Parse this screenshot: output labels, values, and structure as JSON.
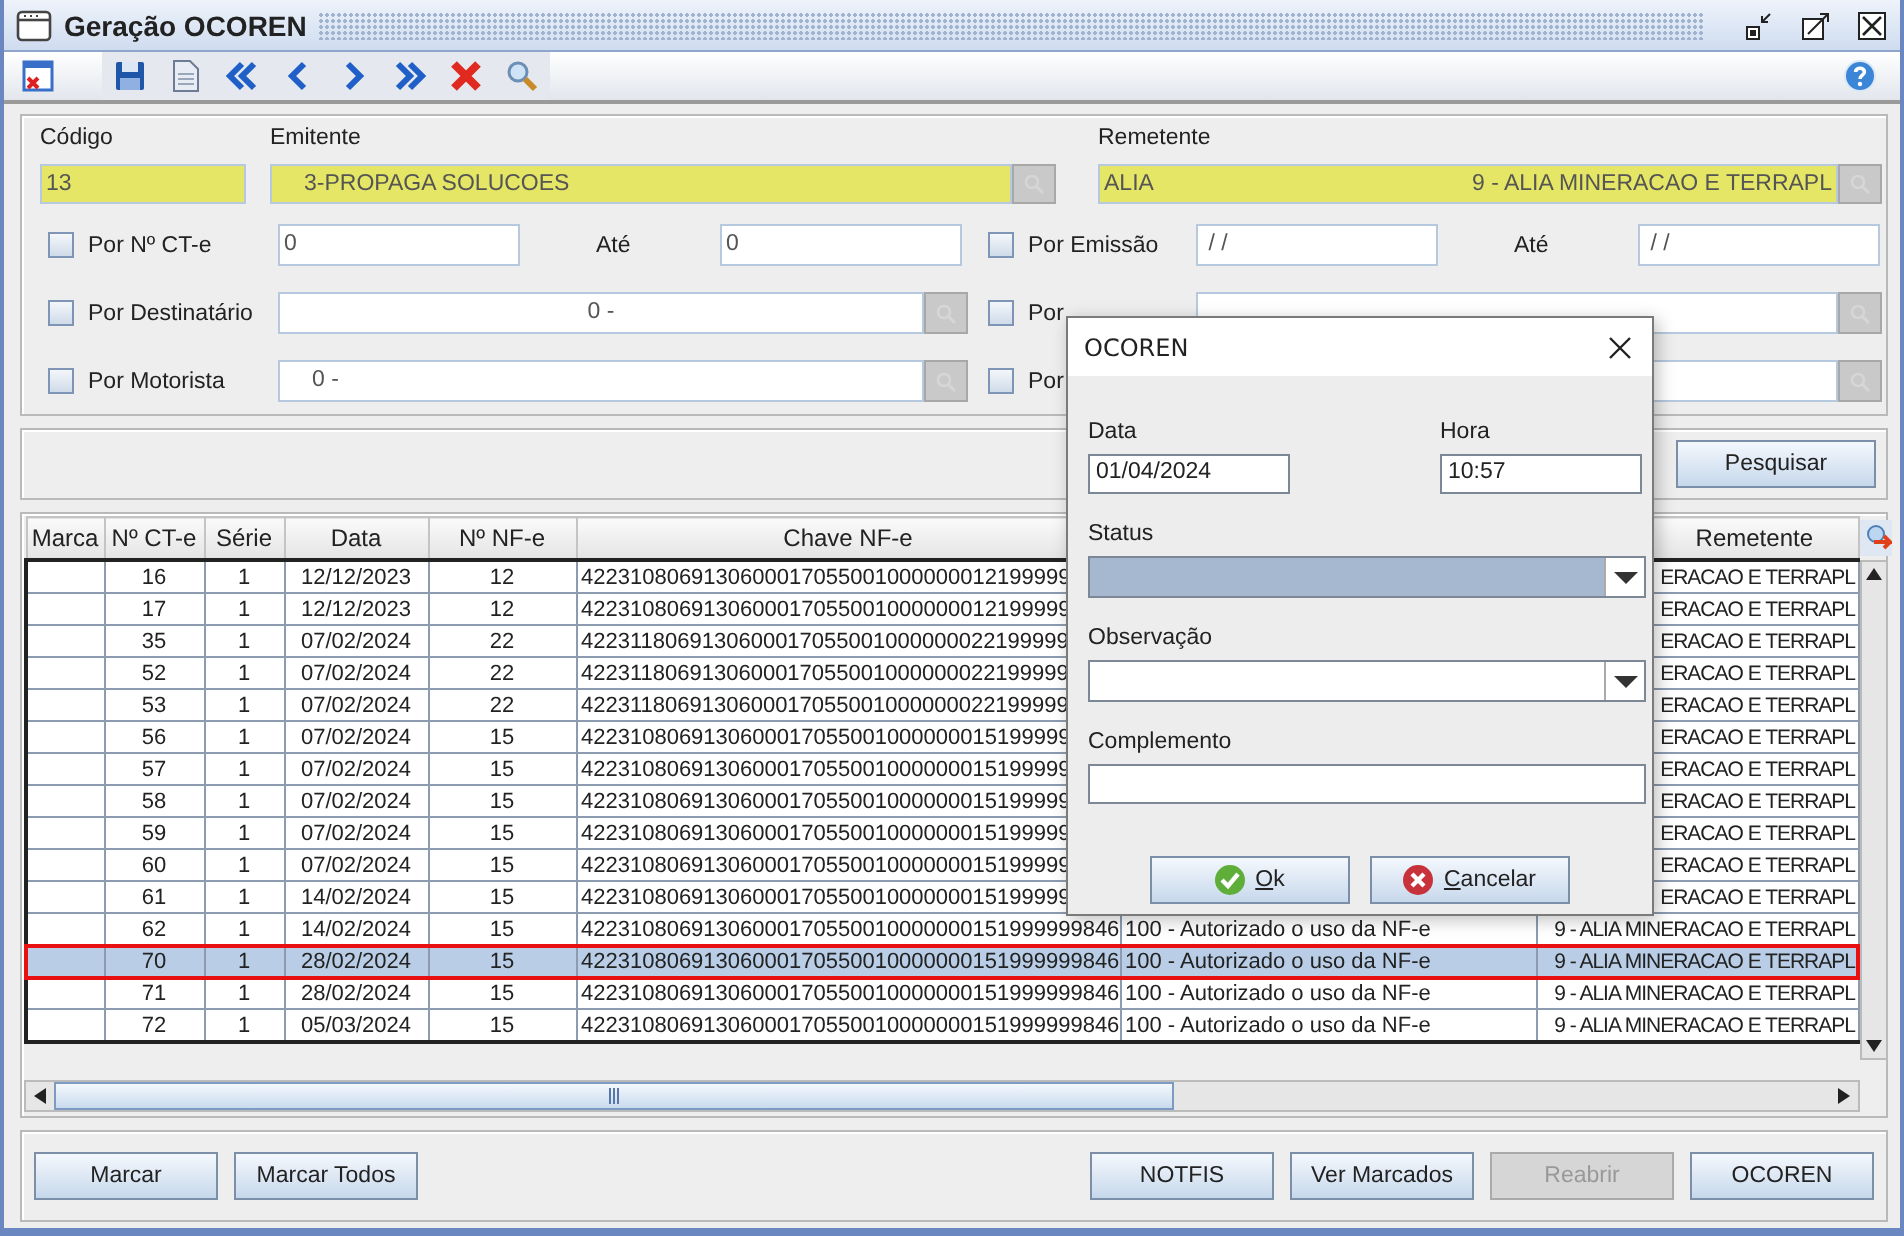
{
  "window": {
    "title": "Geração OCOREN"
  },
  "codigo": {
    "label": "Código",
    "value": "13"
  },
  "emitente": {
    "label": "Emitente",
    "value": "3-PROPAGA SOLUCOES"
  },
  "remetente": {
    "label": "Remetente",
    "code": "ALIA",
    "name": "9 - ALIA MINERACAO E TERRAPL"
  },
  "filters_left": [
    {
      "kind": "range",
      "label": "Por Nº CT-e",
      "checked": false,
      "from": "0",
      "to_label": "Até",
      "to": "0"
    },
    {
      "kind": "lookup",
      "label": "Por Destinatário",
      "checked": false,
      "value": "0 -",
      "centered": true
    },
    {
      "kind": "lookup",
      "label": "Por Motorista",
      "checked": false,
      "value": "0 -",
      "centered": false
    }
  ],
  "filters_right": [
    {
      "kind": "range",
      "label": "Por Emissão",
      "checked": false,
      "from": " / /",
      "to_label": "Até",
      "to": " / /"
    },
    {
      "kind": "lookup",
      "label": "Por",
      "checked": false
    },
    {
      "kind": "lookup",
      "label": "Por",
      "checked": false
    }
  ],
  "search_button": "Pesquisar",
  "table": {
    "columns": [
      "Marca",
      "Nº CT-e",
      "Série",
      "Data",
      "Nº NF-e",
      "Chave NF-e",
      null,
      "Remetente"
    ],
    "rows": [
      {
        "cells": [
          null,
          "16",
          "1",
          "12/12/2023",
          "12",
          "4223108069130600017055001000000012199999",
          null,
          "ERACAO E TERRAPL"
        ],
        "selected": false
      },
      {
        "cells": [
          null,
          "17",
          "1",
          "12/12/2023",
          "12",
          "4223108069130600017055001000000012199999",
          null,
          "ERACAO E TERRAPL"
        ],
        "selected": false
      },
      {
        "cells": [
          null,
          "35",
          "1",
          "07/02/2024",
          "22",
          "4223118069130600017055001000000022199999",
          null,
          "ERACAO E TERRAPL"
        ],
        "selected": false
      },
      {
        "cells": [
          null,
          "52",
          "1",
          "07/02/2024",
          "22",
          "4223118069130600017055001000000022199999",
          null,
          "ERACAO E TERRAPL"
        ],
        "selected": false
      },
      {
        "cells": [
          null,
          "53",
          "1",
          "07/02/2024",
          "22",
          "4223118069130600017055001000000022199999",
          null,
          "ERACAO E TERRAPL"
        ],
        "selected": false
      },
      {
        "cells": [
          null,
          "56",
          "1",
          "07/02/2024",
          "15",
          "4223108069130600017055001000000015199999",
          null,
          "ERACAO E TERRAPL"
        ],
        "selected": false
      },
      {
        "cells": [
          null,
          "57",
          "1",
          "07/02/2024",
          "15",
          "4223108069130600017055001000000015199999",
          null,
          "ERACAO E TERRAPL"
        ],
        "selected": false
      },
      {
        "cells": [
          null,
          "58",
          "1",
          "07/02/2024",
          "15",
          "4223108069130600017055001000000015199999",
          null,
          "ERACAO E TERRAPL"
        ],
        "selected": false
      },
      {
        "cells": [
          null,
          "59",
          "1",
          "07/02/2024",
          "15",
          "4223108069130600017055001000000015199999",
          null,
          "ERACAO E TERRAPL"
        ],
        "selected": false
      },
      {
        "cells": [
          null,
          "60",
          "1",
          "07/02/2024",
          "15",
          "4223108069130600017055001000000015199999",
          null,
          "ERACAO E TERRAPL"
        ],
        "selected": false
      },
      {
        "cells": [
          null,
          "61",
          "1",
          "14/02/2024",
          "15",
          "4223108069130600017055001000000015199999",
          null,
          "ERACAO E TERRAPL"
        ],
        "selected": false
      },
      {
        "cells": [
          null,
          "62",
          "1",
          "14/02/2024",
          "15",
          "42231080691306000170550010000000151999999846",
          "100 - Autorizado o uso da NF-e",
          "9 - ALIA MINERACAO E TERRAPL"
        ],
        "selected": false
      },
      {
        "cells": [
          null,
          "70",
          "1",
          "28/02/2024",
          "15",
          "42231080691306000170550010000000151999999846",
          "100 - Autorizado o uso da NF-e",
          "9 - ALIA MINERACAO E TERRAPL"
        ],
        "selected": true
      },
      {
        "cells": [
          null,
          "71",
          "1",
          "28/02/2024",
          "15",
          "42231080691306000170550010000000151999999846",
          "100 - Autorizado o uso da NF-e",
          "9 - ALIA MINERACAO E TERRAPL"
        ],
        "selected": false
      },
      {
        "cells": [
          null,
          "72",
          "1",
          "05/03/2024",
          "15",
          "42231080691306000170550010000000151999999846",
          "100 - Autorizado o uso da NF-e",
          "9 - ALIA MINERACAO E TERRAPL"
        ],
        "selected": false
      }
    ]
  },
  "buttons_left": [
    {
      "label": "Marcar",
      "disabled": false
    },
    {
      "label": "Marcar Todos",
      "disabled": false
    }
  ],
  "buttons_right": [
    {
      "label": "NOTFIS",
      "disabled": false
    },
    {
      "label": "Ver Marcados",
      "disabled": false
    },
    {
      "label": "Reabrir",
      "disabled": true
    },
    {
      "label": "OCOREN",
      "disabled": false
    }
  ],
  "dialog": {
    "title": "OCOREN",
    "data": {
      "label": "Data",
      "value": "01/04/2024"
    },
    "hora": {
      "label": "Hora",
      "value": "10:57"
    },
    "status": {
      "label": "Status",
      "focused": true
    },
    "observacao": {
      "label": "Observação",
      "focused": false
    },
    "complemento": {
      "label": "Complemento"
    },
    "buttons": [
      {
        "kind": "ok",
        "label": "Ok"
      },
      {
        "kind": "cancel",
        "label": "Cancelar"
      }
    ]
  }
}
